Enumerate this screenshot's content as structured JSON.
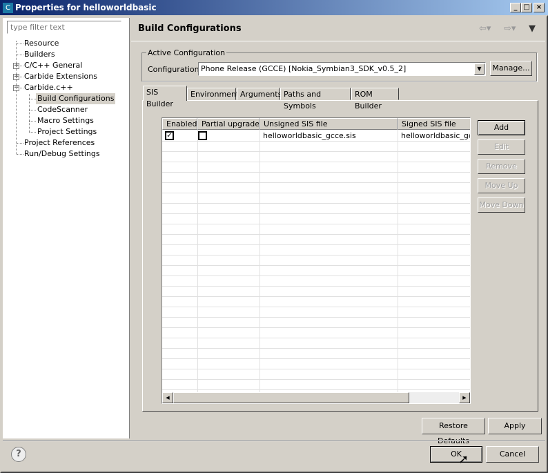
{
  "window": {
    "title": "Properties for helloworldbasic",
    "icon_letter": "C"
  },
  "filter": {
    "placeholder": "type filter text"
  },
  "tree": [
    {
      "label": "Resource"
    },
    {
      "label": "Builders"
    },
    {
      "label": "C/C++ General",
      "expander": "+"
    },
    {
      "label": "Carbide Extensions",
      "expander": "+"
    },
    {
      "label": "Carbide.c++",
      "expander": "−"
    },
    {
      "label": "Build Configurations",
      "selected": true
    },
    {
      "label": "CodeScanner"
    },
    {
      "label": "Macro Settings"
    },
    {
      "label": "Project Settings"
    },
    {
      "label": "Project References"
    },
    {
      "label": "Run/Debug Settings"
    }
  ],
  "page": {
    "title": "Build Configurations"
  },
  "active_config": {
    "group_label": "Active Configuration",
    "label": "Configuration:",
    "value": "Phone Release (GCCE) [Nokia_Symbian3_SDK_v0.5_2]",
    "manage": "Manage..."
  },
  "tabs": [
    "SIS Builder",
    "Environment",
    "Arguments",
    "Paths and Symbols",
    "ROM Builder"
  ],
  "table": {
    "columns": [
      "Enabled",
      "Partial upgrade",
      "Unsigned SIS file",
      "Signed SIS file"
    ],
    "rows": [
      {
        "enabled": true,
        "partial": false,
        "unsigned": "helloworldbasic_gcce.sis",
        "signed": "helloworldbasic_gcce"
      }
    ]
  },
  "side_buttons": {
    "add": "Add",
    "edit": "Edit",
    "remove": "Remove",
    "move_up": "Move Up",
    "move_down": "Move Down"
  },
  "buttons": {
    "restore": "Restore Defaults",
    "apply": "Apply",
    "ok": "OK",
    "cancel": "Cancel"
  }
}
